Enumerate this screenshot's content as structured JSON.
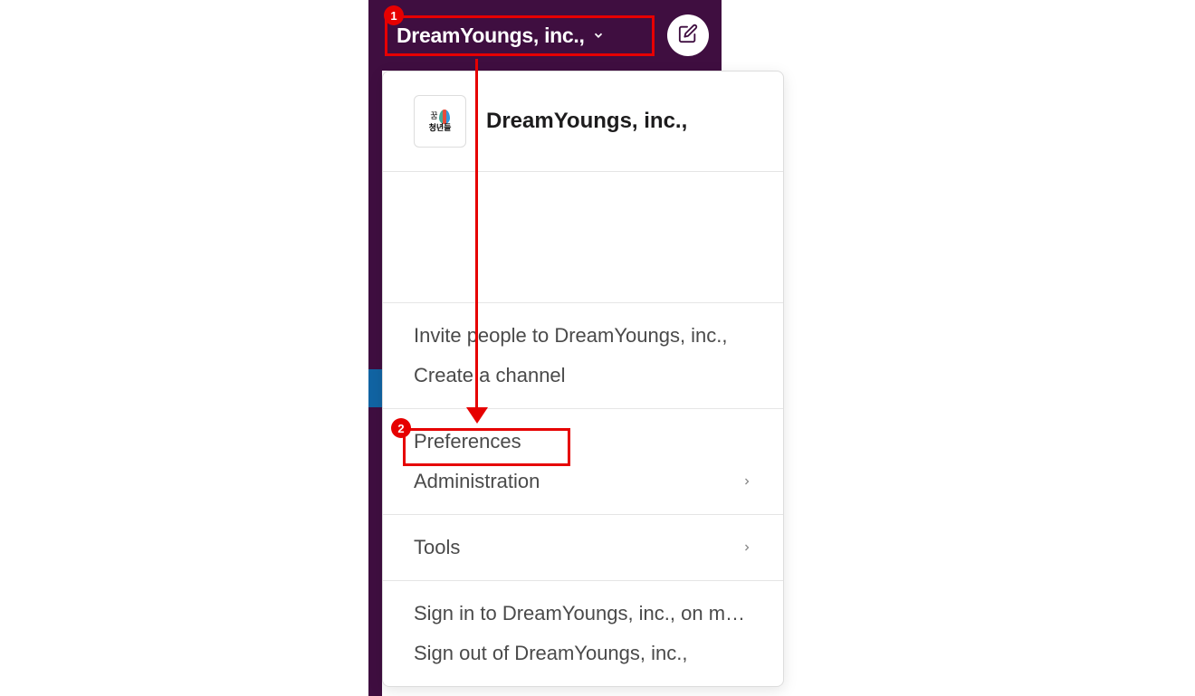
{
  "header": {
    "workspace_name": "DreamYoungs, inc.,"
  },
  "menu": {
    "workspace_title": "DreamYoungs, inc.,",
    "logo_text_top": "꿈",
    "logo_text_bottom": "청년들",
    "sections": [
      {
        "items": [
          {
            "label": "Invite people to DreamYoungs, inc.,",
            "has_submenu": false
          },
          {
            "label": "Create a channel",
            "has_submenu": false
          }
        ]
      },
      {
        "items": [
          {
            "label": "Preferences",
            "has_submenu": false
          },
          {
            "label": "Administration",
            "has_submenu": true
          }
        ]
      },
      {
        "items": [
          {
            "label": "Tools",
            "has_submenu": true
          }
        ]
      },
      {
        "items": [
          {
            "label": "Sign in to DreamYoungs, inc., on mo…",
            "has_submenu": false
          },
          {
            "label": "Sign out of DreamYoungs, inc.,",
            "has_submenu": false
          }
        ]
      }
    ]
  },
  "annotations": {
    "badge_1": "1",
    "badge_2": "2"
  }
}
